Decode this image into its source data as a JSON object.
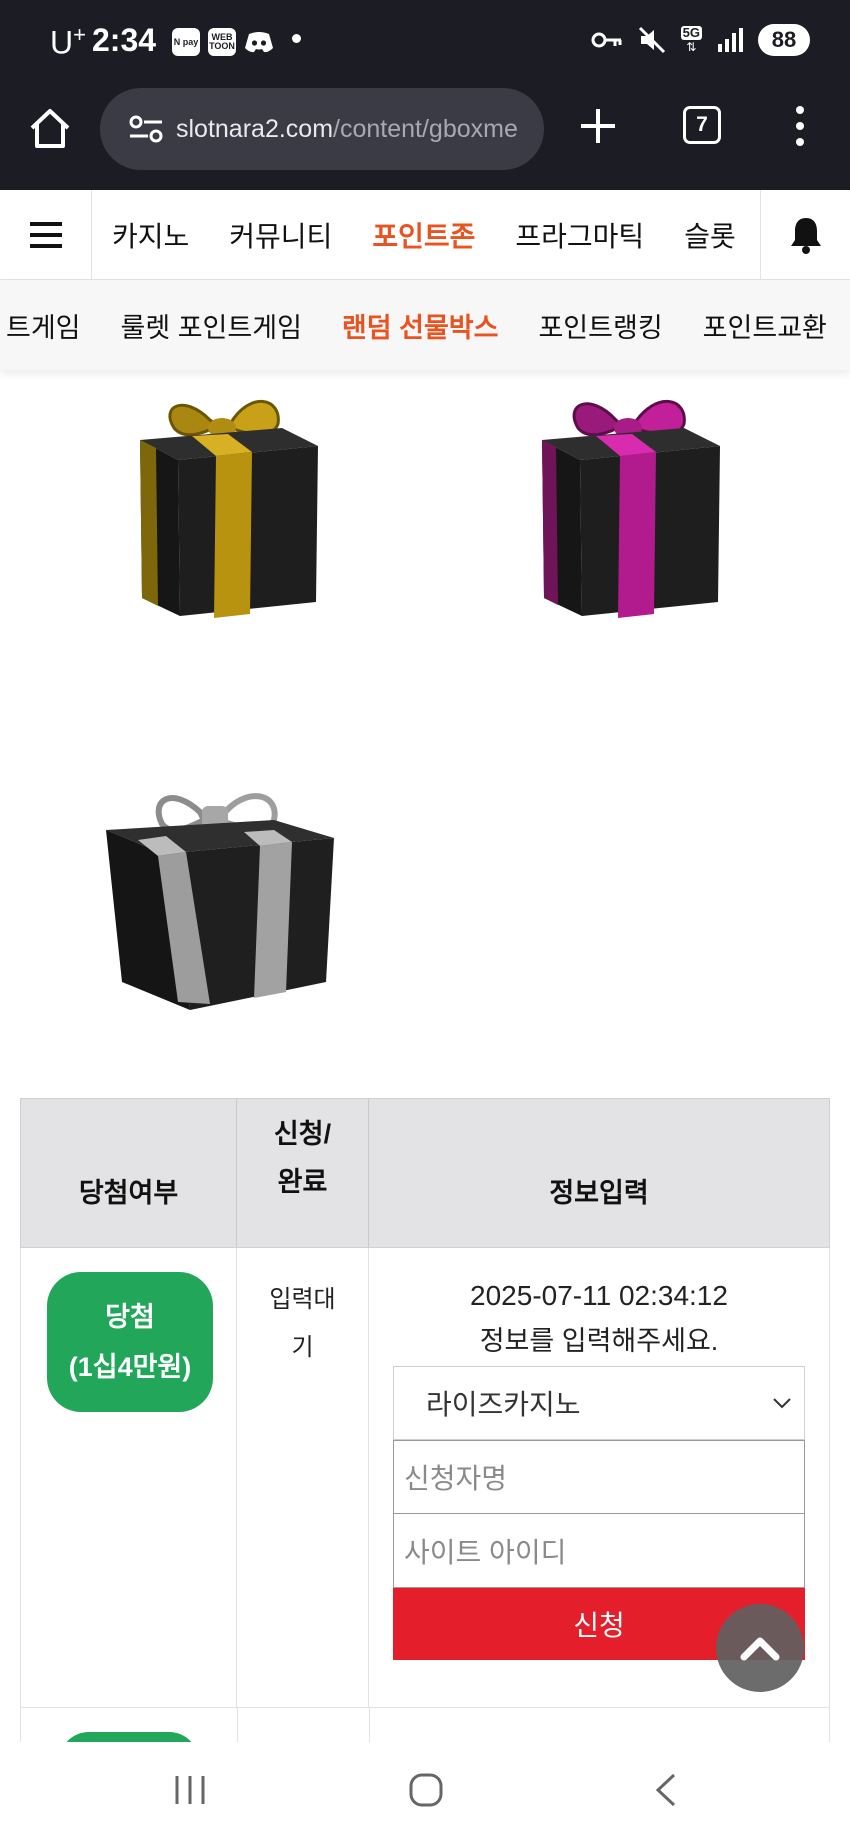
{
  "status_bar": {
    "carrier": "U",
    "carrier_sup": "+",
    "time": "2:34",
    "notif_1": "N pay",
    "notif_2": "WEB TOON",
    "network": "5G",
    "battery": "88"
  },
  "browser": {
    "url_main": "slotnara2.com",
    "url_path": "/content/gboxme",
    "tab_count": "7"
  },
  "nav_primary": {
    "items": [
      "카지노",
      "커뮤니티",
      "포인트존",
      "프라그마틱",
      "슬롯"
    ],
    "active_index": 2
  },
  "nav_secondary": {
    "items": [
      "트게임",
      "룰렛 포인트게임",
      "랜덤 선물박스",
      "포인트랭킹",
      "포인트교환"
    ],
    "active_index": 2
  },
  "gift_boxes": [
    {
      "ribbon_color": "#c9a118",
      "name": "gold-gift-box"
    },
    {
      "ribbon_color": "#c21f9b",
      "name": "magenta-gift-box"
    },
    {
      "ribbon_color": "#9e9e9e",
      "name": "silver-gift-box"
    }
  ],
  "table": {
    "headers": {
      "result": "당첨여부",
      "status_line1": "신청/",
      "status_line2": "완료",
      "info": "정보입력"
    },
    "row": {
      "badge_line1": "당첨",
      "badge_line2": "(1십4만원)",
      "status_line1": "입력대",
      "status_line2": "기",
      "datetime": "2025-07-11 02:34:12",
      "message": "정보를 입력해주세요.",
      "select_value": "라이즈카지노",
      "name_placeholder": "신청자명",
      "site_id_placeholder": "사이트 아이디",
      "submit_label": "신청"
    }
  },
  "colors": {
    "accent": "#e8531f",
    "win_badge": "#22a65a",
    "submit": "#e41e2a"
  }
}
